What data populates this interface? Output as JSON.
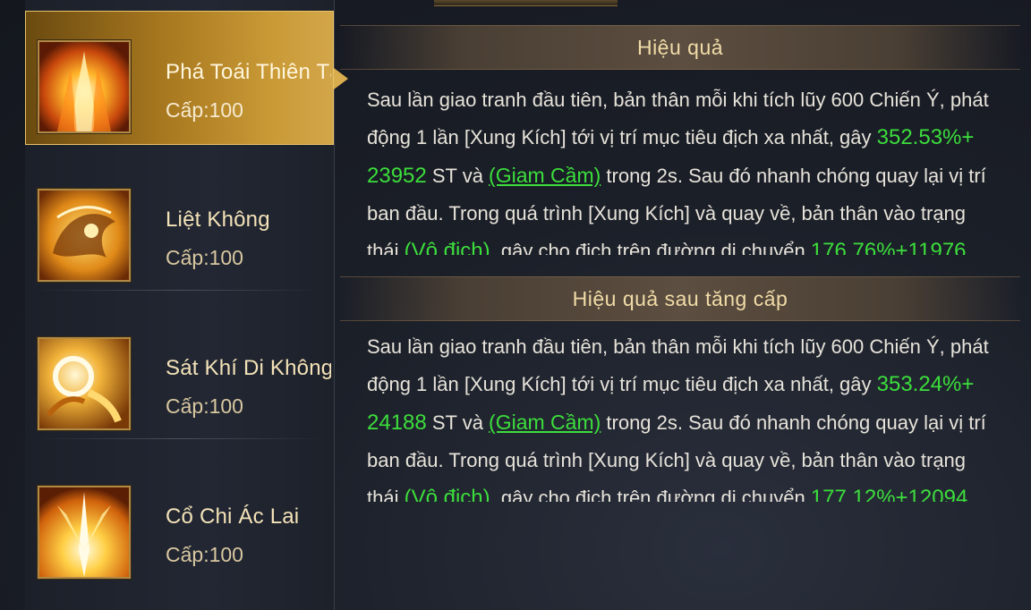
{
  "skills": [
    {
      "name": "Phá Toái Thiên Tạp",
      "level": "Cấp:100",
      "selected": true
    },
    {
      "name": "Liệt Không",
      "level": "Cấp:100",
      "selected": false
    },
    {
      "name": "Sát Khí Di Không",
      "level": "Cấp:100",
      "selected": false
    },
    {
      "name": "Cổ Chi Ác Lai",
      "level": "Cấp:100",
      "selected": false
    }
  ],
  "effect": {
    "title": "Hiệu quả",
    "p1": "Sau lần giao tranh đầu tiên, bản thân mỗi khi tích lũy 600 Chiến Ý, phát động 1 lần [Xung Kích] tới vị trí mục tiêu địch xa nhất, gây ",
    "dmg": "352.53%+ 23952",
    "p2": " ST và ",
    "status": "(Giam Cầm)",
    "p3": " trong 2s. Sau đó nhanh chóng quay lại vị trí ban đầu. Trong quá trình [Xung Kích] và quay về, bản thân vào trạng thái ",
    "invuln": "(Vô địch)",
    "p4": ", gây cho địch trên đường di chuyển ",
    "dmg2": "176.76%+11976"
  },
  "upgrade": {
    "title": "Hiệu quả sau tăng cấp",
    "p1": "Sau lần giao tranh đầu tiên, bản thân mỗi khi tích lũy 600 Chiến Ý, phát động 1 lần [Xung Kích] tới vị trí mục tiêu địch xa nhất, gây ",
    "dmg": "353.24%+ 24188",
    "p2": " ST và ",
    "status": "(Giam Cầm)",
    "p3": " trong 2s. Sau đó nhanh chóng quay lại vị trí ban đầu. Trong quá trình [Xung Kích] và quay về, bản thân vào trạng thái ",
    "invuln": "(Vô địch)",
    "p4": ", gây cho địch trên đường di chuyển ",
    "dmg2": "177.12%+12094"
  },
  "icons": [
    "fire-pillar-icon",
    "golden-beast-icon",
    "golden-swirl-icon",
    "light-burst-icon"
  ],
  "colors": {
    "accent_gold": "#d3a64a",
    "highlight_green": "#3cde3c",
    "title_gold": "#f1dca8"
  }
}
